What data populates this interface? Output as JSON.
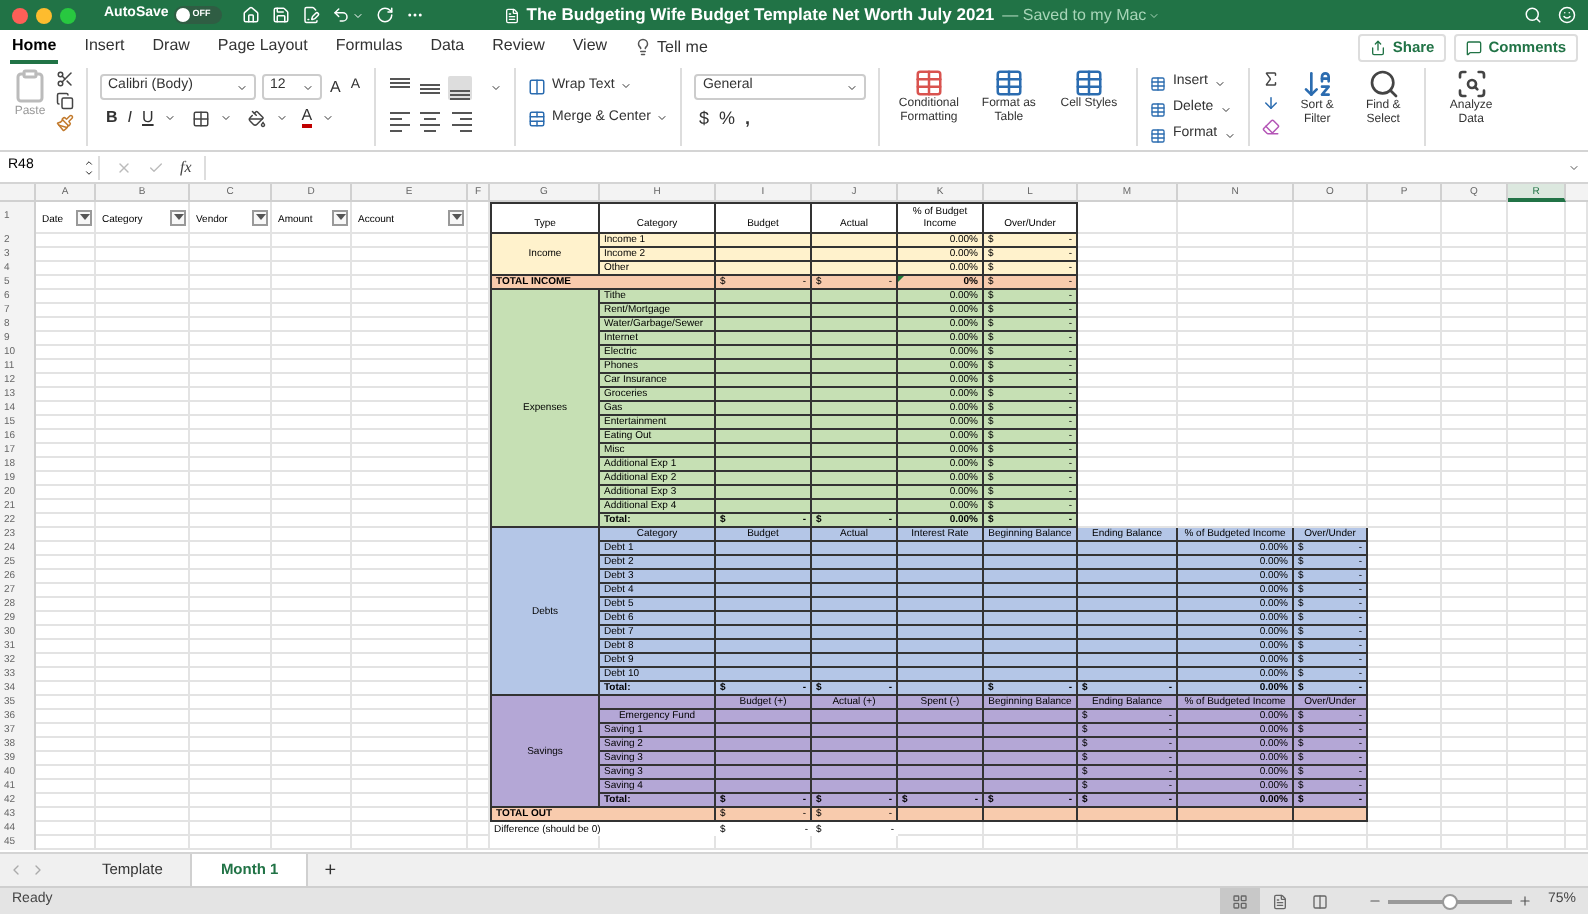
{
  "title_bar": {
    "autosave_label": "AutoSave",
    "autosave": {
      "on": false,
      "label": "OFF"
    },
    "title": "The Budgeting Wife Budget Template Net Worth July 2021",
    "save_status": "— Saved to my Mac"
  },
  "menu": {
    "tabs": [
      {
        "label": "Home",
        "selected": true
      },
      {
        "label": "Insert",
        "selected": false
      },
      {
        "label": "Draw",
        "selected": false
      },
      {
        "label": "Page Layout",
        "selected": false
      },
      {
        "label": "Formulas",
        "selected": false
      },
      {
        "label": "Data",
        "selected": false
      },
      {
        "label": "Review",
        "selected": false
      },
      {
        "label": "View",
        "selected": false
      }
    ],
    "tell_me": "Tell me",
    "share": "Share",
    "comments": "Comments"
  },
  "ribbon": {
    "paste": "Paste",
    "font_name": "Calibri (Body)",
    "font_size": "12",
    "font_grow": "A",
    "font_shrink": "A",
    "styles": [
      "B",
      "I",
      "U"
    ],
    "font_color": "A",
    "wrap_text": "Wrap Text",
    "merge_center": "Merge & Center",
    "number_format": "General",
    "number_buttons": [
      "$",
      "%",
      ","
    ],
    "style_buttons": [
      "Conditional Formatting",
      "Format as Table",
      "Cell Styles"
    ],
    "cell_buttons": [
      "Insert",
      "Delete",
      "Format"
    ],
    "sort_filter": "Sort & Filter",
    "find_select": "Find & Select",
    "analyze": "Analyze Data"
  },
  "formula_bar": {
    "name_box": "R48",
    "function_label": "fx"
  },
  "sheet": {
    "columns": [
      {
        "label": "A",
        "selected": false
      },
      {
        "label": "B",
        "selected": false
      },
      {
        "label": "C",
        "selected": false
      },
      {
        "label": "D",
        "selected": false
      },
      {
        "label": "E",
        "selected": false
      },
      {
        "label": "F",
        "selected": false
      },
      {
        "label": "G",
        "selected": false
      },
      {
        "label": "H",
        "selected": false
      },
      {
        "label": "I",
        "selected": false
      },
      {
        "label": "J",
        "selected": false
      },
      {
        "label": "K",
        "selected": false
      },
      {
        "label": "L",
        "selected": false
      },
      {
        "label": "M",
        "selected": false
      },
      {
        "label": "N",
        "selected": false
      },
      {
        "label": "O",
        "selected": false
      },
      {
        "label": "P",
        "selected": false
      },
      {
        "label": "Q",
        "selected": false
      },
      {
        "label": "R",
        "selected": true
      }
    ],
    "row_numbers": [
      "1",
      "2",
      "3",
      "4",
      "5",
      "6",
      "7",
      "8",
      "9",
      "10",
      "11",
      "12",
      "13",
      "14",
      "15",
      "16",
      "17",
      "18",
      "19",
      "20",
      "21",
      "22",
      "23",
      "24",
      "25",
      "26",
      "27",
      "28",
      "29",
      "30",
      "31",
      "32",
      "33",
      "34",
      "35",
      "36",
      "37",
      "38",
      "39",
      "40",
      "41",
      "42",
      "43",
      "44",
      "45"
    ],
    "log_headers": [
      "Date",
      "Category",
      "Vendor",
      "Amount",
      "Account"
    ],
    "budget": {
      "header": [
        "Type",
        "Category",
        "Budget",
        "Actual",
        "% of Budget Income",
        "Over/Under"
      ],
      "blocks": [
        {
          "kind": "group",
          "type": "Income",
          "color": "#fff2cc",
          "rows": [
            {
              "kind": "item",
              "cells": [
                "Income 1",
                null,
                null,
                "0.00%",
                {
                  "symbol": "$",
                  "amount": "-"
                }
              ]
            },
            {
              "kind": "item",
              "cells": [
                "Income 2",
                null,
                null,
                "0.00%",
                {
                  "symbol": "$",
                  "amount": "-"
                }
              ]
            },
            {
              "kind": "item",
              "cells": [
                "Other",
                null,
                null,
                "0.00%",
                {
                  "symbol": "$",
                  "amount": "-"
                }
              ]
            }
          ]
        },
        {
          "kind": "summary",
          "label": "TOTAL INCOME",
          "color": "#f8cbad",
          "error_indicator": true,
          "cells": [
            {
              "symbol": "$",
              "amount": "-"
            },
            {
              "symbol": "$",
              "amount": "-"
            },
            "0%",
            {
              "symbol": "$",
              "amount": "-"
            }
          ]
        },
        {
          "kind": "group",
          "type": "Expenses",
          "color": "#c6e0b4",
          "rows": [
            {
              "kind": "item",
              "cells": [
                "Tithe",
                null,
                null,
                "0.00%",
                {
                  "symbol": "$",
                  "amount": "-"
                }
              ]
            },
            {
              "kind": "item",
              "cells": [
                "Rent/Mortgage",
                null,
                null,
                "0.00%",
                {
                  "symbol": "$",
                  "amount": "-"
                }
              ]
            },
            {
              "kind": "item",
              "cells": [
                "Water/Garbage/Sewer",
                null,
                null,
                "0.00%",
                {
                  "symbol": "$",
                  "amount": "-"
                }
              ]
            },
            {
              "kind": "item",
              "cells": [
                "Internet",
                null,
                null,
                "0.00%",
                {
                  "symbol": "$",
                  "amount": "-"
                }
              ]
            },
            {
              "kind": "item",
              "cells": [
                "Electric",
                null,
                null,
                "0.00%",
                {
                  "symbol": "$",
                  "amount": "-"
                }
              ]
            },
            {
              "kind": "item",
              "cells": [
                "Phones",
                null,
                null,
                "0.00%",
                {
                  "symbol": "$",
                  "amount": "-"
                }
              ]
            },
            {
              "kind": "item",
              "cells": [
                "Car Insurance",
                null,
                null,
                "0.00%",
                {
                  "symbol": "$",
                  "amount": "-"
                }
              ]
            },
            {
              "kind": "item",
              "cells": [
                "Groceries",
                null,
                null,
                "0.00%",
                {
                  "symbol": "$",
                  "amount": "-"
                }
              ]
            },
            {
              "kind": "item",
              "cells": [
                "Gas",
                null,
                null,
                "0.00%",
                {
                  "symbol": "$",
                  "amount": "-"
                }
              ]
            },
            {
              "kind": "item",
              "cells": [
                "Entertainment",
                null,
                null,
                "0.00%",
                {
                  "symbol": "$",
                  "amount": "-"
                }
              ]
            },
            {
              "kind": "item",
              "cells": [
                "Eating Out",
                null,
                null,
                "0.00%",
                {
                  "symbol": "$",
                  "amount": "-"
                }
              ]
            },
            {
              "kind": "item",
              "cells": [
                "Misc",
                null,
                null,
                "0.00%",
                {
                  "symbol": "$",
                  "amount": "-"
                }
              ]
            },
            {
              "kind": "item",
              "cells": [
                "Additional Exp 1",
                null,
                null,
                "0.00%",
                {
                  "symbol": "$",
                  "amount": "-"
                }
              ]
            },
            {
              "kind": "item",
              "cells": [
                "Additional Exp 2",
                null,
                null,
                "0.00%",
                {
                  "symbol": "$",
                  "amount": "-"
                }
              ]
            },
            {
              "kind": "item",
              "cells": [
                "Additional Exp 3",
                null,
                null,
                "0.00%",
                {
                  "symbol": "$",
                  "amount": "-"
                }
              ]
            },
            {
              "kind": "item",
              "cells": [
                "Additional Exp 4",
                null,
                null,
                "0.00%",
                {
                  "symbol": "$",
                  "amount": "-"
                }
              ]
            },
            {
              "kind": "total",
              "cells": [
                "Total:",
                {
                  "symbol": "$",
                  "amount": "-"
                },
                {
                  "symbol": "$",
                  "amount": "-"
                },
                "0.00%",
                {
                  "symbol": "$",
                  "amount": "-"
                }
              ]
            }
          ]
        },
        {
          "kind": "group",
          "type": "Debts",
          "color": "#b4c6e7",
          "rows": [
            {
              "kind": "header",
              "cells": [
                "Category",
                "Budget",
                "Actual",
                "Interest Rate",
                "Beginning Balance",
                "Ending Balance",
                "% of Budgeted Income",
                "Over/Under"
              ]
            },
            {
              "kind": "item",
              "cells": [
                "Debt 1",
                null,
                null,
                null,
                null,
                null,
                "0.00%",
                {
                  "symbol": "$",
                  "amount": "-"
                }
              ]
            },
            {
              "kind": "item",
              "cells": [
                "Debt 2",
                null,
                null,
                null,
                null,
                null,
                "0.00%",
                {
                  "symbol": "$",
                  "amount": "-"
                }
              ]
            },
            {
              "kind": "item",
              "cells": [
                "Debt 3",
                null,
                null,
                null,
                null,
                null,
                "0.00%",
                {
                  "symbol": "$",
                  "amount": "-"
                }
              ]
            },
            {
              "kind": "item",
              "cells": [
                "Debt 4",
                null,
                null,
                null,
                null,
                null,
                "0.00%",
                {
                  "symbol": "$",
                  "amount": "-"
                }
              ]
            },
            {
              "kind": "item",
              "cells": [
                "Debt 5",
                null,
                null,
                null,
                null,
                null,
                "0.00%",
                {
                  "symbol": "$",
                  "amount": "-"
                }
              ]
            },
            {
              "kind": "item",
              "cells": [
                "Debt 6",
                null,
                null,
                null,
                null,
                null,
                "0.00%",
                {
                  "symbol": "$",
                  "amount": "-"
                }
              ]
            },
            {
              "kind": "item",
              "cells": [
                "Debt 7",
                null,
                null,
                null,
                null,
                null,
                "0.00%",
                {
                  "symbol": "$",
                  "amount": "-"
                }
              ]
            },
            {
              "kind": "item",
              "cells": [
                "Debt 8",
                null,
                null,
                null,
                null,
                null,
                "0.00%",
                {
                  "symbol": "$",
                  "amount": "-"
                }
              ]
            },
            {
              "kind": "item",
              "cells": [
                "Debt 9",
                null,
                null,
                null,
                null,
                null,
                "0.00%",
                {
                  "symbol": "$",
                  "amount": "-"
                }
              ]
            },
            {
              "kind": "item",
              "cells": [
                "Debt 10",
                null,
                null,
                null,
                null,
                null,
                "0.00%",
                {
                  "symbol": "$",
                  "amount": "-"
                }
              ]
            },
            {
              "kind": "total",
              "cells": [
                "Total:",
                {
                  "symbol": "$",
                  "amount": "-"
                },
                {
                  "symbol": "$",
                  "amount": "-"
                },
                null,
                {
                  "symbol": "$",
                  "amount": "-"
                },
                {
                  "symbol": "$",
                  "amount": "-"
                },
                "0.00%",
                {
                  "symbol": "$",
                  "amount": "-"
                }
              ]
            }
          ]
        },
        {
          "kind": "group",
          "type": "Savings",
          "color": "#b4a7d6",
          "rows": [
            {
              "kind": "header",
              "cells": [
                null,
                "Budget (+)",
                "Actual (+)",
                "Spent (-)",
                "Beginning Balance",
                "Ending Balance",
                "% of Budgeted Income",
                "Over/Under"
              ]
            },
            {
              "kind": "item",
              "label_centered": true,
              "cells": [
                "Emergency Fund",
                null,
                null,
                null,
                null,
                {
                  "symbol": "$",
                  "amount": "-"
                },
                "0.00%",
                {
                  "symbol": "$",
                  "amount": "-"
                }
              ]
            },
            {
              "kind": "item",
              "cells": [
                "Saving 1",
                null,
                null,
                null,
                null,
                {
                  "symbol": "$",
                  "amount": "-"
                },
                "0.00%",
                {
                  "symbol": "$",
                  "amount": "-"
                }
              ]
            },
            {
              "kind": "item",
              "cells": [
                "Saving 2",
                null,
                null,
                null,
                null,
                {
                  "symbol": "$",
                  "amount": "-"
                },
                "0.00%",
                {
                  "symbol": "$",
                  "amount": "-"
                }
              ]
            },
            {
              "kind": "item",
              "cells": [
                "Saving 3",
                null,
                null,
                null,
                null,
                {
                  "symbol": "$",
                  "amount": "-"
                },
                "0.00%",
                {
                  "symbol": "$",
                  "amount": "-"
                }
              ]
            },
            {
              "kind": "item",
              "cells": [
                "Saving 3",
                null,
                null,
                null,
                null,
                {
                  "symbol": "$",
                  "amount": "-"
                },
                "0.00%",
                {
                  "symbol": "$",
                  "amount": "-"
                }
              ]
            },
            {
              "kind": "item",
              "cells": [
                "Saving 4",
                null,
                null,
                null,
                null,
                {
                  "symbol": "$",
                  "amount": "-"
                },
                "0.00%",
                {
                  "symbol": "$",
                  "amount": "-"
                }
              ]
            },
            {
              "kind": "total",
              "cells": [
                "Total:",
                {
                  "symbol": "$",
                  "amount": "-"
                },
                {
                  "symbol": "$",
                  "amount": "-"
                },
                {
                  "symbol": "$",
                  "amount": "-"
                },
                {
                  "symbol": "$",
                  "amount": "-"
                },
                {
                  "symbol": "$",
                  "amount": "-"
                },
                "0.00%",
                {
                  "symbol": "$",
                  "amount": "-"
                }
              ]
            }
          ]
        },
        {
          "kind": "summary",
          "label": "TOTAL OUT",
          "color": "#f8cbad",
          "error_indicator": false,
          "cells": [
            {
              "symbol": "$",
              "amount": "-"
            },
            {
              "symbol": "$",
              "amount": "-"
            },
            null,
            null,
            null,
            null,
            null
          ]
        },
        {
          "kind": "plain",
          "label": "Difference (should be 0)",
          "cells": [
            {
              "symbol": "$",
              "amount": "-"
            },
            {
              "symbol": "$",
              "amount": "-"
            }
          ]
        }
      ]
    }
  },
  "sheet_tabs": [
    {
      "label": "Template",
      "selected": false
    },
    {
      "label": "Month 1",
      "selected": true
    }
  ],
  "add_sheet": "+",
  "status_bar": {
    "status": "Ready",
    "views": [
      {
        "kind": "normal",
        "selected": true
      },
      {
        "kind": "page_layout",
        "selected": false
      },
      {
        "kind": "page_break",
        "selected": false
      }
    ],
    "zoom": {
      "level": 0.5
    },
    "zoom_label": "75%"
  }
}
